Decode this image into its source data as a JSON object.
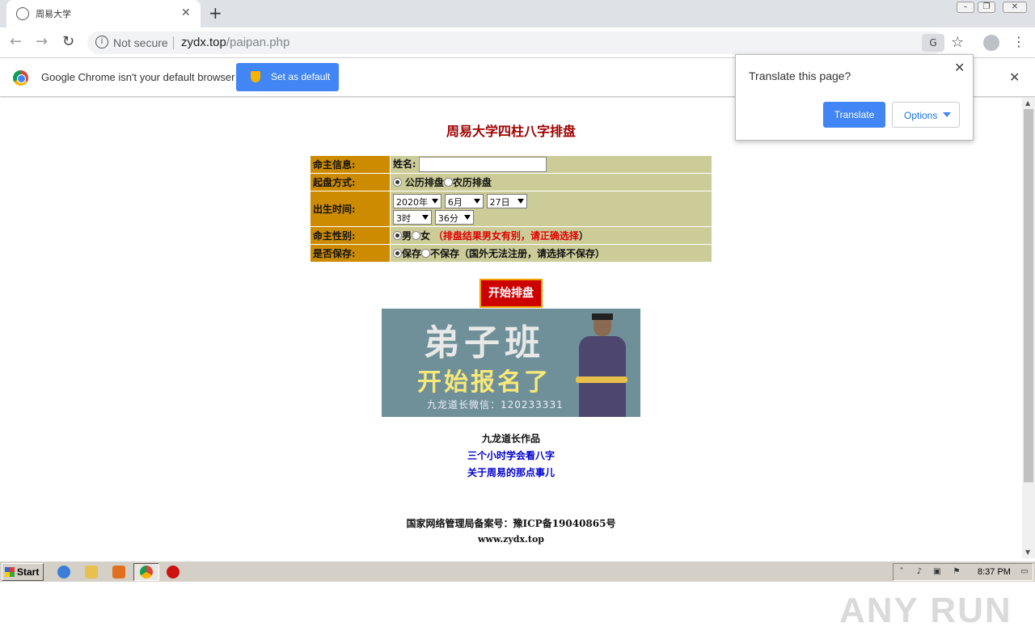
{
  "browser": {
    "tab_title": "周易大学",
    "security_label": "Not secure",
    "url_host": "zydx.top",
    "url_path": "/paipan.php"
  },
  "infobar": {
    "message": "Google Chrome isn't your default browser",
    "set_default_label": "Set as default"
  },
  "translate_bubble": {
    "question": "Translate this page?",
    "translate_label": "Translate",
    "options_label": "Options"
  },
  "page": {
    "title": "周易大学四柱八字排盘",
    "form": {
      "row_info_label": "命主信息:",
      "name_label": "姓名:",
      "name_value": "",
      "row_method_label": "起盘方式:",
      "method_options": [
        "公历排盘",
        "农历排盘"
      ],
      "method_selected": "公历排盘",
      "row_birth_label": "出生时间:",
      "birth": {
        "year": "2020年",
        "month": "6月",
        "day": "27日",
        "hour": "3时",
        "minute": "36分"
      },
      "row_gender_label": "命主性别:",
      "gender_options": [
        "男",
        "女"
      ],
      "gender_selected": "男",
      "gender_warning_open": "（",
      "gender_warning": "排盘结果男女有别，请正确选择",
      "gender_warning_close": "）",
      "row_save_label": "是否保存:",
      "save_options": [
        "保存",
        "不保存（国外无法注册，请选择不保存）"
      ],
      "save_selected": "保存"
    },
    "start_button": "开始排盘",
    "banner": {
      "line1": "弟子班",
      "line2": "开始报名了",
      "line3": "九龙道长微信：120233331"
    },
    "author": "九龙道长作品",
    "link1": "三个小时学会看八字",
    "link2": "关于周易的那点事儿",
    "icp": "国家网络管理局备案号：豫ICP备19040865号",
    "site": "www.zydx.top"
  },
  "watermark": "ANY RUN",
  "taskbar": {
    "start_label": "Start",
    "clock": "8:37 PM"
  },
  "colors": {
    "title_red": "#a00000",
    "label_bg": "#cc8b00",
    "value_bg": "#cccc99",
    "button_red": "#cc0000",
    "chrome_blue": "#4285f4"
  }
}
